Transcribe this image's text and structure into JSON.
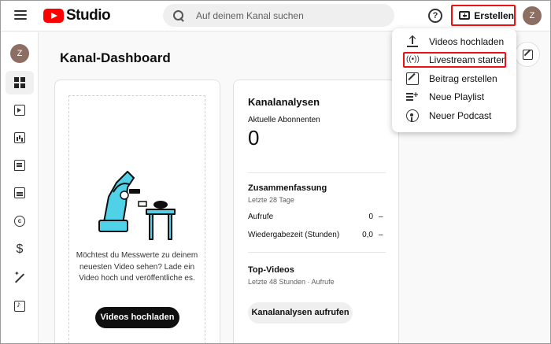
{
  "header": {
    "logo_text": "Studio",
    "search_placeholder": "Auf deinem Kanal suchen",
    "help_symbol": "?",
    "create_label": "Erstellen",
    "avatar_initial": "Z"
  },
  "sidebar": {
    "avatar_initial": "Z",
    "items": [
      {
        "name": "dashboard",
        "icon": "dashboard-icon",
        "active": true
      },
      {
        "name": "content",
        "icon": "content-icon"
      },
      {
        "name": "analytics",
        "icon": "analytics-icon"
      },
      {
        "name": "comments",
        "icon": "comments-icon"
      },
      {
        "name": "subtitles",
        "icon": "subtitles-icon"
      },
      {
        "name": "copyright",
        "icon": "copyright-icon",
        "glyph": "c"
      },
      {
        "name": "earn",
        "icon": "dollar-icon",
        "glyph": "$"
      },
      {
        "name": "customization",
        "icon": "magic-wand-icon"
      },
      {
        "name": "audio-library",
        "icon": "audio-library-icon"
      }
    ]
  },
  "main": {
    "title": "Kanal-Dashboard",
    "upload_card": {
      "text": "Möchtest du Messwerte zu deinem neuesten Video sehen? Lade ein Video hoch und veröffentliche es.",
      "button": "Videos hochladen"
    },
    "analytics_card": {
      "title": "Kanalanalysen",
      "subs_label": "Aktuelle Abonnenten",
      "subs_value": "0",
      "summary_title": "Zusammenfassung",
      "summary_period": "Letzte 28 Tage",
      "rows": [
        {
          "label": "Aufrufe",
          "value": "0",
          "trend": "–"
        },
        {
          "label": "Wiedergabezeit (Stunden)",
          "value": "0,0",
          "trend": "–"
        }
      ],
      "top_videos_title": "Top-Videos",
      "top_videos_sub": "Letzte 48 Stunden · Aufrufe",
      "button": "Kanalanalysen aufrufen"
    }
  },
  "create_menu": {
    "items": [
      {
        "label": "Videos hochladen",
        "icon": "upload-icon"
      },
      {
        "label": "Livestream starten",
        "icon": "live-icon",
        "glyph": "((•))"
      },
      {
        "label": "Beitrag erstellen",
        "icon": "post-edit-icon"
      },
      {
        "label": "Neue Playlist",
        "icon": "playlist-add-icon"
      },
      {
        "label": "Neuer Podcast",
        "icon": "podcast-icon"
      }
    ]
  },
  "colors": {
    "brand_red": "#ff0000",
    "highlight_red": "#ee1111",
    "avatar": "#8d6e63"
  }
}
